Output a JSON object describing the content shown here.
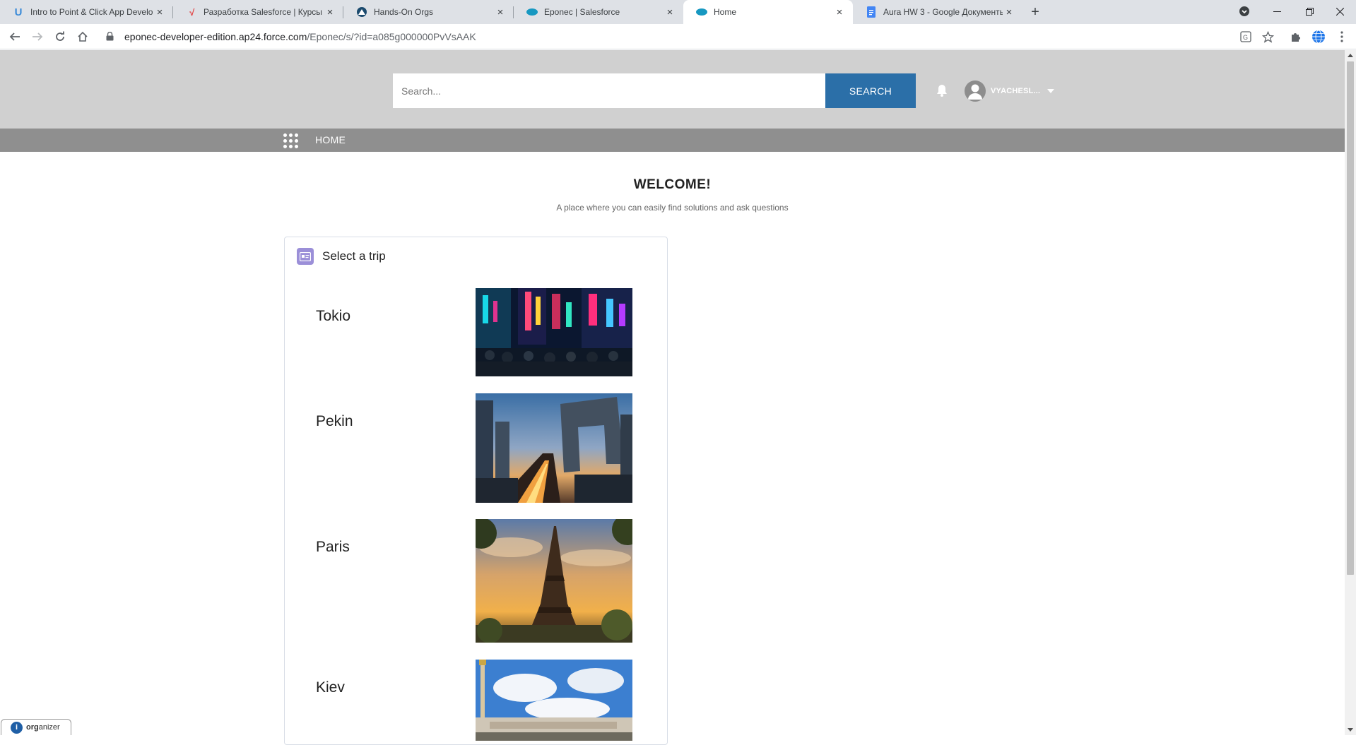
{
  "browser": {
    "tabs": [
      {
        "title": "Intro to Point & Click App Develo",
        "icon": "udemy-u-icon",
        "active": false
      },
      {
        "title": "Разработка Salesforce | Курсы и",
        "icon": "course-logo-icon",
        "active": false
      },
      {
        "title": "Hands-On Orgs",
        "icon": "trailhead-icon",
        "active": false
      },
      {
        "title": "Eponec | Salesforce",
        "icon": "salesforce-cloud-icon",
        "active": false
      },
      {
        "title": "Home",
        "icon": "salesforce-cloud-icon",
        "active": true
      },
      {
        "title": "Aura HW 3 - Google Документы",
        "icon": "google-docs-icon",
        "active": false
      }
    ],
    "url_host": "eponec-developer-edition.ap24.force.com",
    "url_path": "/Eponec/s/?id=a085g000000PvVsAAK"
  },
  "header": {
    "search_placeholder": "Search...",
    "search_button": "SEARCH",
    "username": "VYACHESL..."
  },
  "nav": {
    "home_label": "HOME"
  },
  "main": {
    "welcome_title": "WELCOME!",
    "welcome_subtitle": "A place where you can easily find solutions and ask questions"
  },
  "card": {
    "title": "Select a trip",
    "trips": [
      {
        "name": "Tokio",
        "image": "neon-night-street-photo"
      },
      {
        "name": "Pekin",
        "image": "city-skyline-dusk-photo"
      },
      {
        "name": "Paris",
        "image": "eiffel-tower-sunset-photo"
      },
      {
        "name": "Kiev",
        "image": "monument-blue-sky-photo"
      }
    ]
  },
  "extension": {
    "label_bold": "org",
    "label_rest": "anizer"
  }
}
